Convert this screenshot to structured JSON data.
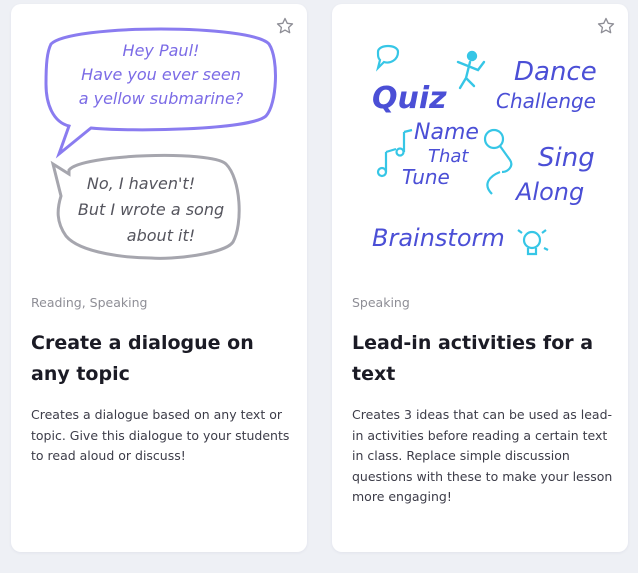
{
  "cards": [
    {
      "category": "Reading, Speaking",
      "title": "Create a dialogue on any topic",
      "description": "Creates a dialogue based on any text or topic. Give this dialogue to your students to read aloud or discuss!",
      "illustration": {
        "bubble1": [
          "Hey Paul!",
          "Have you ever seen",
          "a yellow submarine?"
        ],
        "bubble2": [
          "No, I haven't!",
          "But I wrote a song",
          "about it!"
        ]
      },
      "favorite_icon": "star-outline-icon"
    },
    {
      "category": "Speaking",
      "title": "Lead-in activities for a text",
      "description": "Creates 3 ideas that can be used as lead-in activities before reading a certain text in class. Replace simple discussion questions with these to make your lesson more engaging!",
      "illustration": {
        "quiz": "Quiz",
        "dance1": "Dance",
        "dance2": "Challenge",
        "name1": "Name",
        "name2": "That",
        "name3": "Tune",
        "sing1": "Sing",
        "sing2": "Along",
        "brainstorm": "Brainstorm"
      },
      "favorite_icon": "star-outline-icon"
    }
  ],
  "colors": {
    "bubble_purple": "#8a7cf0",
    "bubble_gray": "#a6a6ae",
    "bubble_text_purple": "#7b6be6",
    "bubble_text_gray": "#55555e",
    "word_blue": "#4b4fd6",
    "icon_cyan": "#36c6e6"
  }
}
